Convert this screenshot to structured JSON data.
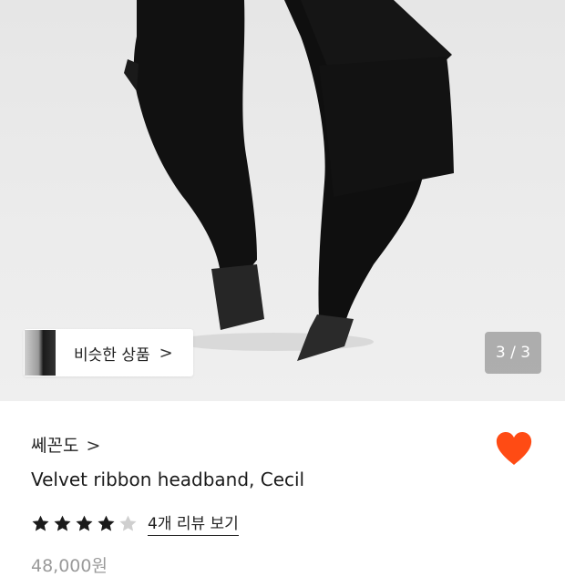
{
  "hero": {
    "similar_label": "비슷한 상품",
    "similar_chevron": ">",
    "counter": "3 / 3"
  },
  "product": {
    "brand": "쎄꼰도",
    "brand_chevron": ">",
    "title": "Velvet ribbon headband, Cecil",
    "rating_stars": 4,
    "rating_max": 5,
    "reviews_label": "4개 리뷰 보기",
    "price": "48,000원"
  },
  "colors": {
    "accent": "#ff4b14",
    "star_filled": "#1a1a1a",
    "star_empty": "#cfcfcf"
  },
  "icons": {
    "heart": "heart-icon",
    "star": "star-icon"
  }
}
